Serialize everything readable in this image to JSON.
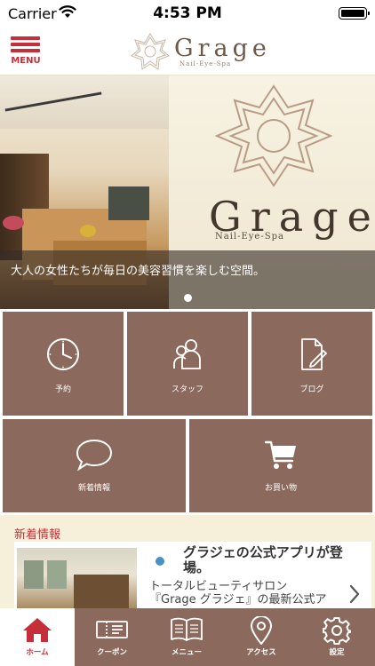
{
  "status_bar": {
    "carrier": "Carrier",
    "time": "4:53 PM"
  },
  "header": {
    "menu_label": "MENU",
    "logo_text": "Grage",
    "logo_sub": "Nail-Eye-Spa"
  },
  "hero": {
    "sign_text": "Grage",
    "sign_sub": "Nail-Eye-Spa",
    "caption": "大人の女性たちが毎日の美容習慣を楽しむ空間。",
    "slides_count": 1,
    "active_slide": 1
  },
  "grid": {
    "tiles": [
      {
        "label": "予約",
        "icon": "clock-icon"
      },
      {
        "label": "スタッフ",
        "icon": "staff-icon"
      },
      {
        "label": "ブログ",
        "icon": "blog-icon"
      },
      {
        "label": "新着情報",
        "icon": "speech-bubble-icon"
      },
      {
        "label": "お買い物",
        "icon": "cart-icon"
      }
    ]
  },
  "news": {
    "heading": "新着情報",
    "item": {
      "title": "グラジェの公式アプリが登場。",
      "body_line1": "トータルビューティサロン",
      "body_line2": "『Grage グラジェ』の最新公式ア"
    }
  },
  "tabbar": {
    "tabs": [
      {
        "label": "ホーム",
        "icon": "home-icon",
        "active": true
      },
      {
        "label": "クーポン",
        "icon": "coupon-icon",
        "active": false
      },
      {
        "label": "メニュー",
        "icon": "book-icon",
        "active": false
      },
      {
        "label": "アクセス",
        "icon": "map-pin-icon",
        "active": false
      },
      {
        "label": "設定",
        "icon": "gear-icon",
        "active": false
      }
    ]
  },
  "colors": {
    "brand_red": "#c62f39",
    "tile_brown": "#8b6a5d",
    "background_cream": "#f6efd9",
    "news_dot_blue": "#4a92c4"
  }
}
